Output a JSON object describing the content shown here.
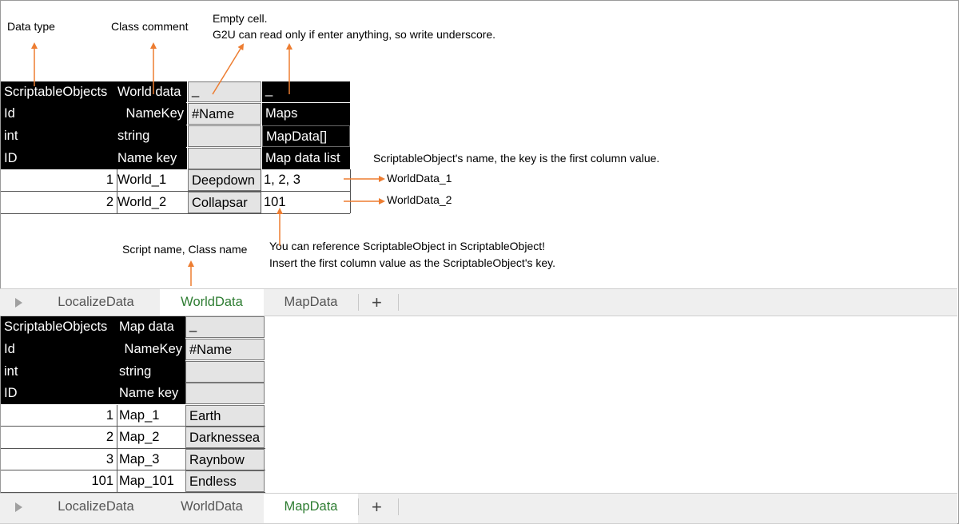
{
  "annotations": {
    "data_type": "Data type",
    "class_comment": "Class comment",
    "empty_cell_line1": "Empty cell.",
    "empty_cell_line2": "G2U can read only if enter anything, so write underscore.",
    "scriptable_name": "ScriptableObject's name, the key is the first column value.",
    "worlddata_1": "WorldData_1",
    "worlddata_2": "WorldData_2",
    "script_name": "Script name, Class name",
    "reference_line1": "You can reference ScriptableObject in ScriptableObject!",
    "reference_line2": "Insert the first column value as the ScriptableObject's key."
  },
  "world_sheet": {
    "r1": {
      "c1": "ScriptableObjects",
      "c2": "World data",
      "c3": "_",
      "c4": "_"
    },
    "r2": {
      "c1": "Id",
      "c2": "NameKey",
      "c3": "#Name",
      "c4": "Maps"
    },
    "r3": {
      "c1": "int",
      "c2": "string",
      "c3": "",
      "c4": "MapData[]"
    },
    "r4": {
      "c1": "ID",
      "c2": "Name key",
      "c3": "",
      "c4": "Map data list"
    },
    "rows": [
      {
        "id": "1",
        "key": "World_1",
        "name": "Deepdown",
        "maps": "1, 2, 3"
      },
      {
        "id": "2",
        "key": "World_2",
        "name": "Collapsar",
        "maps": "101"
      }
    ]
  },
  "tabs_top": {
    "t1": "LocalizeData",
    "t2": "WorldData",
    "t3": "MapData",
    "add": "+",
    "active": "WorldData"
  },
  "map_sheet": {
    "r1": {
      "c1": "ScriptableObjects",
      "c2": "Map data",
      "c3": "_"
    },
    "r2": {
      "c1": "Id",
      "c2": "NameKey",
      "c3": "#Name"
    },
    "r3": {
      "c1": "int",
      "c2": "string",
      "c3": ""
    },
    "r4": {
      "c1": "ID",
      "c2": "Name key",
      "c3": ""
    },
    "rows": [
      {
        "id": "1",
        "key": "Map_1",
        "name": "Earth"
      },
      {
        "id": "2",
        "key": "Map_2",
        "name": "Darknessea"
      },
      {
        "id": "3",
        "key": "Map_3",
        "name": "Raynbow"
      },
      {
        "id": "101",
        "key": "Map_101",
        "name": "Endless"
      }
    ]
  },
  "tabs_bottom": {
    "t1": "LocalizeData",
    "t2": "WorldData",
    "t3": "MapData",
    "add": "+",
    "active": "MapData"
  },
  "colors": {
    "accent_arrow": "#ed7d31",
    "active_tab_text": "#2e7d32",
    "header_bg": "#000000",
    "cell_grey": "#e4e4e4"
  }
}
